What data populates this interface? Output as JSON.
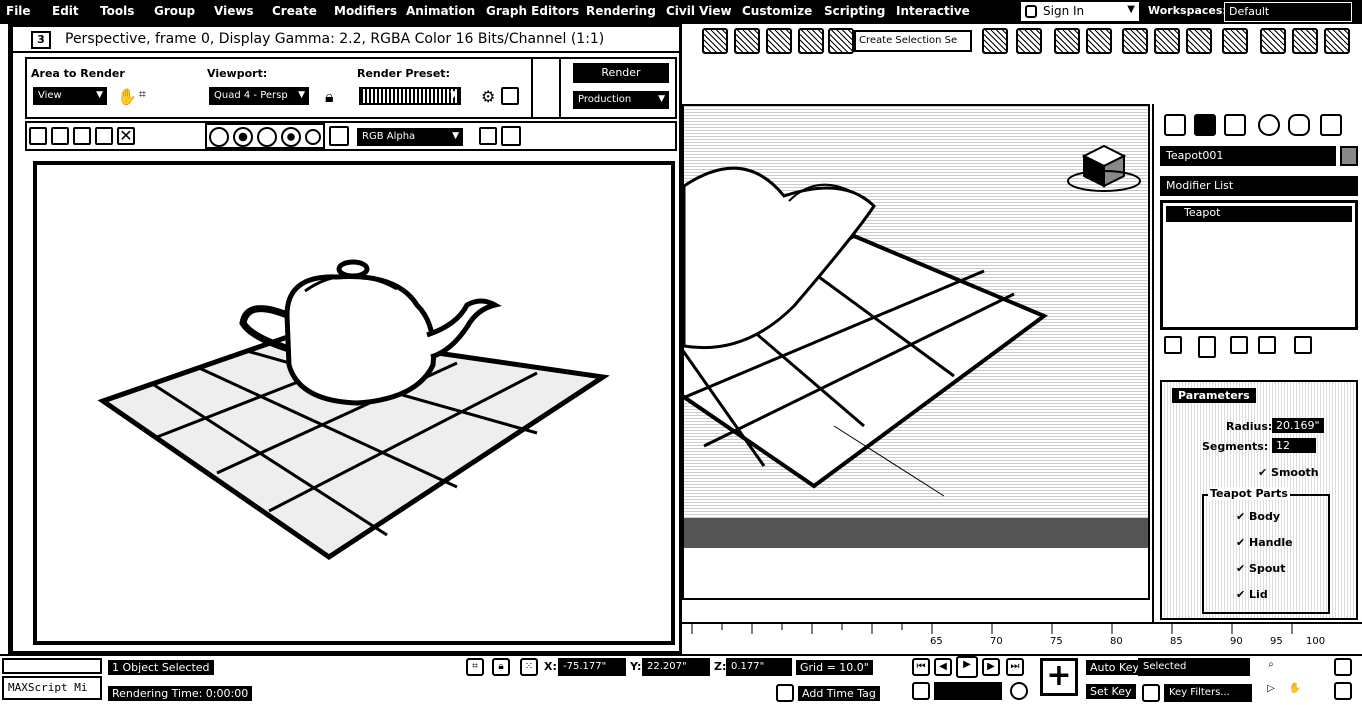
{
  "menu": [
    "File",
    "Edit",
    "Tools",
    "Group",
    "Views",
    "Create",
    "Modifiers",
    "Animation",
    "Graph Editors",
    "Rendering",
    "Civil View",
    "Customize",
    "Scripting",
    "Interactive"
  ],
  "account": {
    "signin": "Sign In",
    "workspaces_label": "Workspaces:",
    "workspace_value": "Default"
  },
  "toolbar": {
    "selection_set": "Create Selection Se"
  },
  "frame_buffer": {
    "title": "Perspective, frame 0, Display Gamma: 2.2, RGBA Color 16 Bits/Channel (1:1)",
    "area_to_render_label": "Area to Render",
    "area_to_render_value": "View",
    "viewport_label": "Viewport:",
    "viewport_value": "Quad 4 - Persp",
    "render_preset_label": "Render Preset:",
    "render_preset_value": "",
    "render_button": "Render",
    "production_value": "Production",
    "channel_value": "RGB Alpha"
  },
  "command_panel": {
    "object_name": "Teapot001",
    "modifier_list": "Modifier List",
    "stack_item": "Teapot",
    "parameters_title": "Parameters",
    "radius_label": "Radius:",
    "radius_value": "20.169\"",
    "segments_label": "Segments:",
    "segments_value": "12",
    "smooth_label": "Smooth",
    "teapot_parts_title": "Teapot Parts",
    "parts": [
      "Body",
      "Handle",
      "Spout",
      "Lid"
    ]
  },
  "timeline": {
    "ticks": [
      "65",
      "70",
      "75",
      "80",
      "85",
      "90",
      "95",
      "100"
    ]
  },
  "status": {
    "maxscript": "MAXScript Mi",
    "objects_selected": "1 Object Selected",
    "rendering_time": "Rendering Time: 0:00:00",
    "x_label": "X:",
    "x_value": "-75.177\"",
    "y_label": "Y:",
    "y_value": "22.207\"",
    "z_label": "Z:",
    "z_value": "0.177\"",
    "grid": "Grid = 10.0\"",
    "add_time_tag": "Add Time Tag",
    "auto_key": "Auto Key",
    "set_key": "Set Key",
    "selected": "Selected",
    "key_filters": "Key Filters..."
  }
}
